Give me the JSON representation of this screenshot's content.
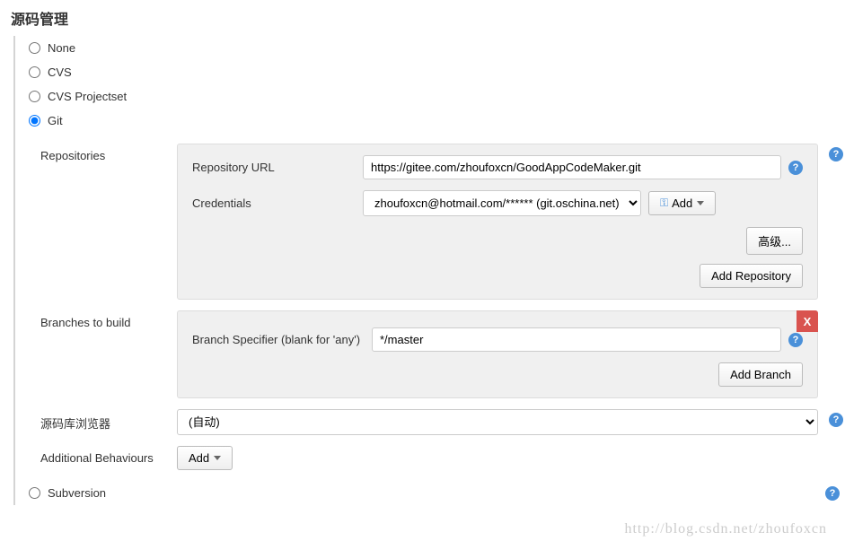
{
  "section_title": "源码管理",
  "scm_options": {
    "none": "None",
    "cvs": "CVS",
    "cvs_projectset": "CVS Projectset",
    "git": "Git",
    "subversion": "Subversion"
  },
  "repositories": {
    "label": "Repositories",
    "repo_url_label": "Repository URL",
    "repo_url_value": "https://gitee.com/zhoufoxcn/GoodAppCodeMaker.git",
    "credentials_label": "Credentials",
    "credentials_value": "zhoufoxcn@hotmail.com/****** (git.oschina.net)",
    "add_cred_label": "Add",
    "advanced_btn": "高级...",
    "add_repo_btn": "Add Repository"
  },
  "branches": {
    "label": "Branches to build",
    "specifier_label": "Branch Specifier (blank for 'any')",
    "specifier_value": "*/master",
    "add_branch_btn": "Add Branch",
    "close_x": "X"
  },
  "browser": {
    "label": "源码库浏览器",
    "value": "(自动)"
  },
  "additional": {
    "label": "Additional Behaviours",
    "add_btn": "Add"
  },
  "help_char": "?",
  "watermark": "http://blog.csdn.net/zhoufoxcn"
}
